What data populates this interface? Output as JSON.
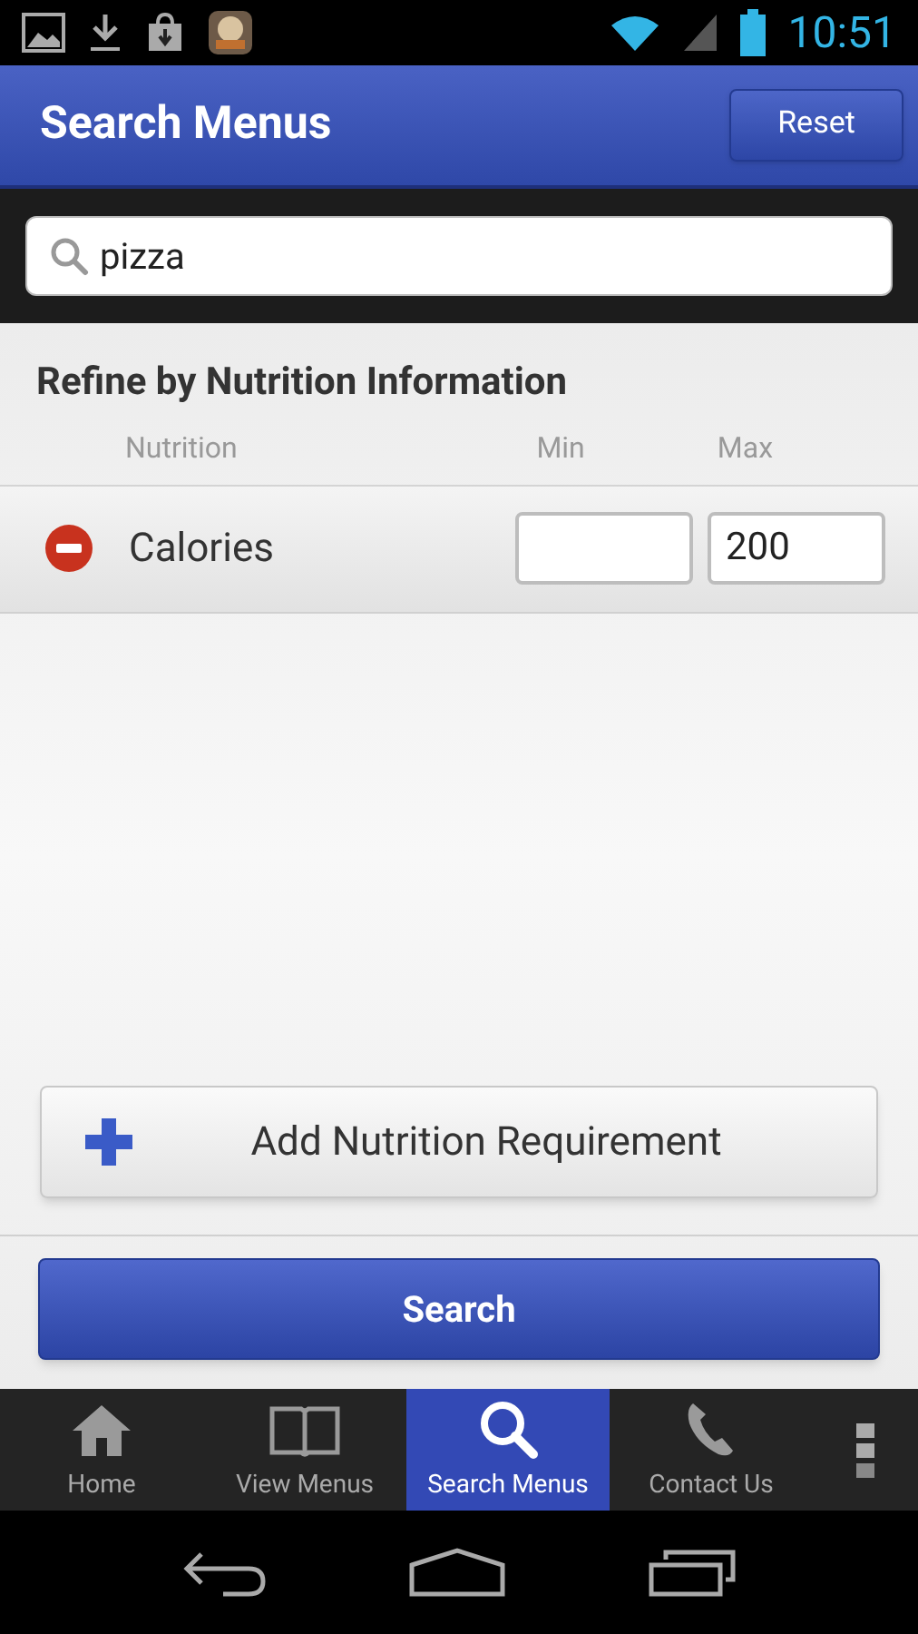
{
  "status_bar": {
    "time": "10:51"
  },
  "app_bar": {
    "title": "Search Menus",
    "reset_button": "Reset"
  },
  "search": {
    "value": "pizza"
  },
  "refine": {
    "title": "Refine by Nutrition Information",
    "columns": [
      "Nutrition",
      "Min",
      "Max"
    ],
    "rows": [
      {
        "name": "Calories",
        "min": "",
        "max": "200"
      }
    ],
    "add_button": "Add Nutrition Requirement"
  },
  "search_button": "Search",
  "tabs": [
    {
      "label": "Home",
      "kind": "home",
      "selected": false
    },
    {
      "label": "View Menus",
      "kind": "book",
      "selected": false
    },
    {
      "label": "Search Menus",
      "kind": "search",
      "selected": true
    },
    {
      "label": "Contact Us",
      "kind": "phone",
      "selected": false
    }
  ]
}
